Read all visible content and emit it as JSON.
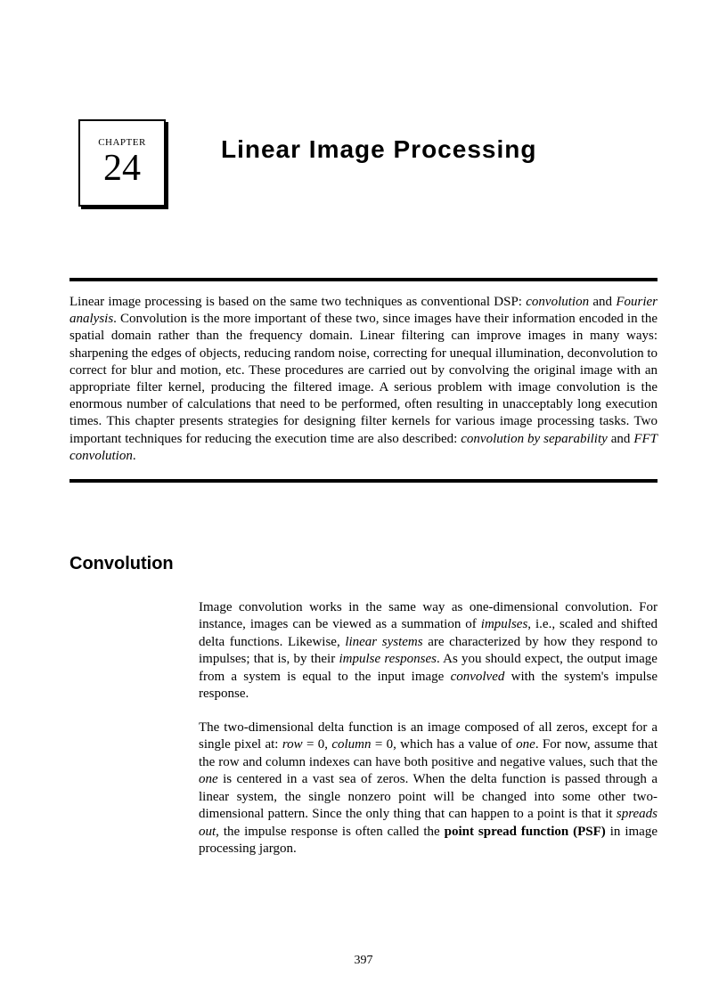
{
  "chapter": {
    "label": "CHAPTER",
    "number": "24",
    "title": "Linear Image Processing"
  },
  "intro": {
    "seg1": "Linear image processing is based on the same two techniques as conventional DSP: ",
    "ital1": "convolution",
    "seg2": " and ",
    "ital2": "Fourier analysis",
    "seg3": ".  Convolution is the more important of these two, since images have their information encoded in the spatial domain rather than the frequency domain.   Linear filtering can improve images in many ways: sharpening the edges of objects, reducing random noise, correcting for unequal illumination, deconvolution to correct for blur and motion, etc.  These procedures are carried out by convolving the original image with an appropriate filter kernel, producing the filtered image.  A serious problem with image convolution is the enormous number of calculations that need to be performed, often resulting in unacceptably long execution times.  This chapter presents strategies for designing filter kernels for various image processing tasks.  Two important techniques for reducing the execution time are also described: ",
    "ital3": "convolution by separability",
    "seg4": " and ",
    "ital4": "FFT convolution",
    "seg5": "."
  },
  "sections": {
    "convolution": {
      "heading": "Convolution",
      "p1": {
        "s1": "Image convolution works in the same way as one-dimensional convolution.  For instance, images can be viewed as a summation of ",
        "i1": "impulses",
        "s2": ", i.e., scaled and shifted delta functions.  Likewise, ",
        "i2": "linear systems",
        "s3": " are characterized by how they respond to impulses; that is, by their ",
        "i3": "impulse responses",
        "s4": ".  As you should expect, the output image from a system is equal to the input image ",
        "i4": "convolved",
        "s5": " with the system's impulse response."
      },
      "p2": {
        "s1": "The two-dimensional delta function is an image composed of all zeros, except for a single pixel at: ",
        "i1": "row",
        "s2": " = 0, ",
        "i2": "column",
        "s3": " = 0, which has a value of ",
        "i3": "one",
        "s4": ".  For now, assume that the row and column indexes can have both positive and negative values, such that the ",
        "i4": "one",
        "s5": " is centered in a vast sea of zeros. When the delta function is passed through a linear system, the single nonzero point will be changed into some other two-dimensional pattern.  Since the only thing that can happen to a point is that it ",
        "i5": "spreads out",
        "s6": ", the impulse response is often called the ",
        "b1": "point spread function (PSF)",
        "s7": " in image processing jargon."
      }
    }
  },
  "page_number": "397"
}
